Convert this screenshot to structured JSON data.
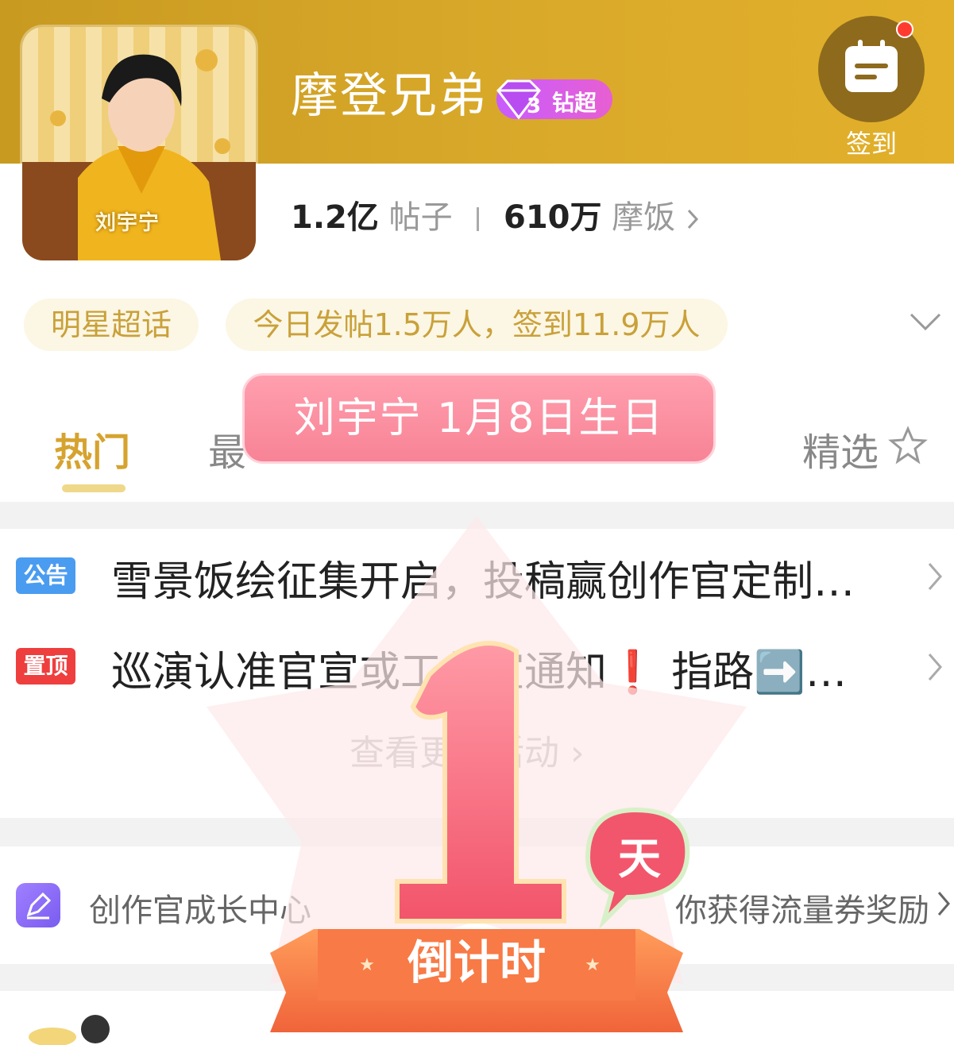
{
  "header": {
    "title": "摩登兄弟",
    "level_badge": "钻超",
    "level_num": "3",
    "signin_label": "签到"
  },
  "avatar": {
    "caption": "刘宇宁"
  },
  "stats": {
    "posts_value": "1.2亿",
    "posts_label": "帖子",
    "fans_value": "610万",
    "fans_label": "摩饭"
  },
  "tags": {
    "category": "明星超话",
    "activity": "今日发帖1.5万人，签到11.9万人"
  },
  "tabs": {
    "hot": "热门",
    "latest": "最",
    "featured": "精选"
  },
  "birthday_banner": "刘宇宁 1月8日生日",
  "notices": [
    {
      "badge": "公告",
      "badge_color": "#4a9cf0",
      "text": "雪景饭绘征集开启，投稿赢创作官定制…"
    },
    {
      "badge": "置顶",
      "badge_color": "#ef3e3e",
      "text": "巡演认准官宣或工作室通知❗ 指路➡️…"
    }
  ],
  "more_activities": "查看更多活动 ›",
  "creator": {
    "label": "创作官成长中心",
    "reward": "你获得流量券奖励"
  },
  "countdown": {
    "number": "1",
    "unit": "天",
    "ribbon": "倒计时"
  },
  "colors": {
    "header_gold": "#d9a92a",
    "accent_gold": "#d6a32f",
    "banner_pink": "#f78396",
    "badge_blue": "#4a9cf0",
    "badge_red": "#ef3e3e"
  }
}
